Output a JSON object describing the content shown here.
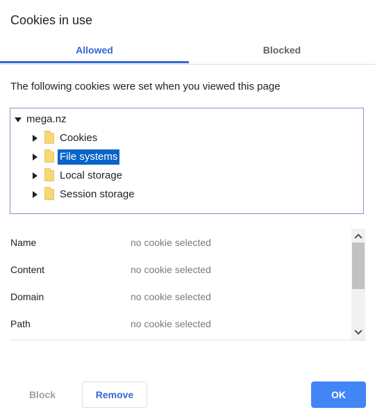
{
  "dialog": {
    "title": "Cookies in use"
  },
  "tabs": [
    {
      "label": "Allowed",
      "active": true
    },
    {
      "label": "Blocked",
      "active": false
    }
  ],
  "intro_text": "The following cookies were set when you viewed this page",
  "tree": {
    "root": {
      "label": "mega.nz",
      "expanded": true
    },
    "children": [
      {
        "label": "Cookies",
        "icon": "folder-icon",
        "selected": false
      },
      {
        "label": "File systems",
        "icon": "folder-icon",
        "selected": true
      },
      {
        "label": "Local storage",
        "icon": "folder-icon",
        "selected": false
      },
      {
        "label": "Session storage",
        "icon": "folder-icon",
        "selected": false
      }
    ]
  },
  "details": [
    {
      "label": "Name",
      "value": "no cookie selected"
    },
    {
      "label": "Content",
      "value": "no cookie selected"
    },
    {
      "label": "Domain",
      "value": "no cookie selected"
    },
    {
      "label": "Path",
      "value": "no cookie selected"
    }
  ],
  "buttons": {
    "block": "Block",
    "remove": "Remove",
    "ok": "OK"
  },
  "colors": {
    "accent": "#3367d6",
    "primary_button": "#4285f4",
    "selection": "#0a64c8",
    "folder": "#f6d876"
  }
}
